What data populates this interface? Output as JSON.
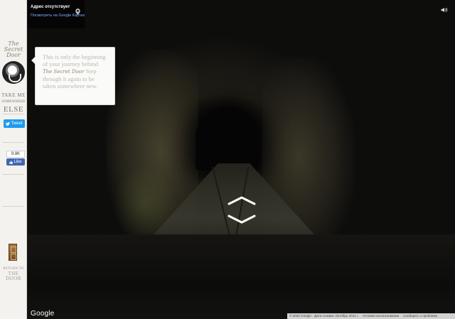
{
  "sidebar": {
    "logo_text": "The Secret Door",
    "take_me_line1": "TAKE ME",
    "take_me_line2": "SOMEWHERE",
    "take_me_line3": "ELSE",
    "tweet_label": "Tweet",
    "fb_count": "9.8K",
    "fb_like_label": "Like",
    "return_line1": "RETURN TO",
    "return_line2": "THE DOOR"
  },
  "bubble": {
    "text_before": "This is only the beginning of your journey behind",
    "brand": "The Secret Door",
    "text_after": "Step through it again to be taken somewhere new."
  },
  "streetview": {
    "address_title": "Адрес отсутствует",
    "maps_link": "Посмотреть на Google Картах"
  },
  "footer": {
    "google_logo": "Google",
    "copyright": "© 2020 Google · Дата съемки: Октябрь 2011 г.",
    "terms": "Условия использования",
    "report": "Сообщить о проблеме"
  },
  "colors": {
    "sidebar_bg": "#f4f2ee",
    "tweet_blue": "#1d9bf0",
    "facebook_blue": "#4267b2",
    "link_blue": "#7fb1ff"
  },
  "icons": [
    "lion-knocker-icon",
    "twitter-bird-icon",
    "facebook-thumb-icon",
    "door-icon",
    "location-pin-icon",
    "sound-icon",
    "arrow-forward-icon",
    "arrow-back-icon"
  ]
}
